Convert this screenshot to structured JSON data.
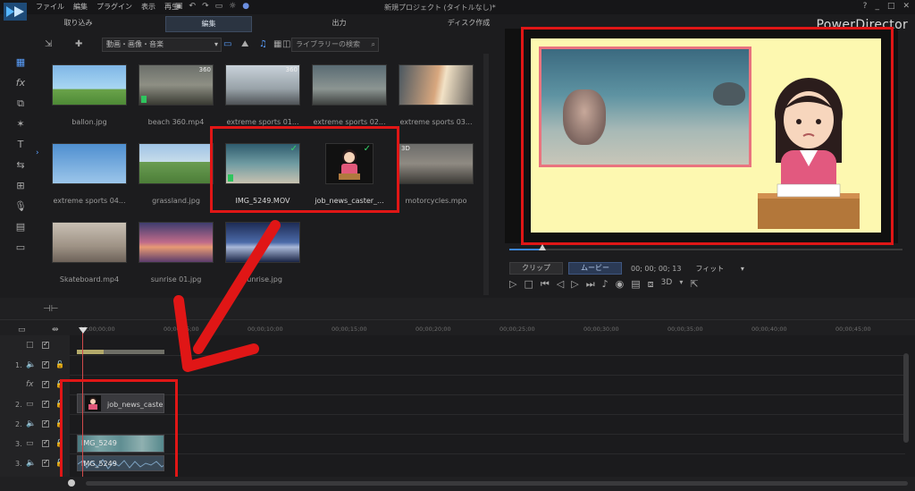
{
  "window": {
    "title": "新規プロジェクト (タイトルなし)*",
    "brand": "PowerDirector",
    "menu": [
      "ファイル",
      "編集",
      "プラグイン",
      "表示",
      "再生"
    ],
    "controls": [
      "?",
      "_",
      "□",
      "✕"
    ]
  },
  "tabs": [
    {
      "label": "取り込み",
      "active": false
    },
    {
      "label": "編集",
      "active": true
    },
    {
      "label": "出力",
      "active": false
    },
    {
      "label": "ディスク作成",
      "active": false
    }
  ],
  "library_toolbar": {
    "filter_dropdown": "動画・画像・音楽",
    "search_placeholder": "ライブラリーの検索"
  },
  "media": [
    {
      "name": "ballon.jpg"
    },
    {
      "name": "beach 360.mp4",
      "badge": "360"
    },
    {
      "name": "extreme sports 01...",
      "badge": "360"
    },
    {
      "name": "extreme sports 02..."
    },
    {
      "name": "extreme sports 03..."
    },
    {
      "name": "extreme sports 04..."
    },
    {
      "name": "grassland.jpg"
    },
    {
      "name": "IMG_5249.MOV",
      "checked": true
    },
    {
      "name": "job_news_caster_...",
      "checked": true
    },
    {
      "name": "motorcycles.mpo",
      "badge": "3D"
    },
    {
      "name": "Skateboard.mp4"
    },
    {
      "name": "sunrise 01.jpg"
    },
    {
      "name": "sunrise.jpg"
    }
  ],
  "preview": {
    "clip_button": "クリップ",
    "movie_button": "ムービー",
    "timecode": "00; 00; 00; 13",
    "fit": "フィット",
    "mode_3d": "3D",
    "scrub_progress": 0.08
  },
  "timeline": {
    "ruler": [
      "00;00;00;00",
      "00;00;05;00",
      "00;00;10;00",
      "00;00;15;00",
      "00;00;20;00",
      "00;00;25;00",
      "00;00;30;00",
      "00;00;35;00",
      "00;00;40;00",
      "00;00;45;00"
    ],
    "tracks": [
      {
        "num": "1.",
        "icon": "speaker-icon"
      },
      {
        "num": "",
        "icon": "fx-icon",
        "symbol": "fx"
      },
      {
        "num": "2.",
        "icon": "video-track-icon"
      },
      {
        "num": "2.",
        "icon": "speaker-icon"
      },
      {
        "num": "3.",
        "icon": "video-track-icon"
      },
      {
        "num": "3.",
        "icon": "speaker-icon"
      }
    ],
    "clips": {
      "news_caster": "job_news_caster",
      "video": "IMG_5249",
      "audio": "IMG_5249"
    }
  },
  "colors": {
    "highlight_red": "#e01616",
    "preview_bg": "#fdf8b0",
    "pip_border": "#e9737f",
    "check_green": "#35d46b"
  }
}
